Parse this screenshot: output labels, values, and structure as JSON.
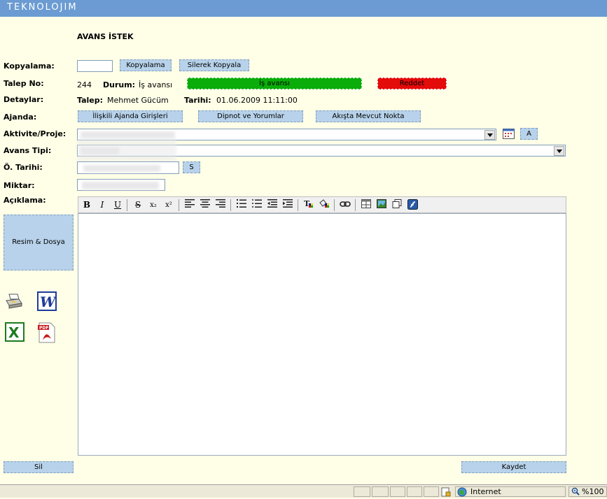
{
  "header": {
    "brand": "TEKNOLOJIM"
  },
  "page": {
    "title": "AVANS İSTEK"
  },
  "labels": {
    "kopyalama": "Kopyalama:",
    "talep_no": "Talep No:",
    "detaylar": "Detaylar:",
    "ajanda": "Ajanda:",
    "aktivite": "Aktivite/Proje:",
    "avans_tipi": "Avans Tipi:",
    "o_tarihi": "Ö. Tarihi:",
    "miktar": "Miktar:",
    "aciklama": "Açıklama:"
  },
  "buttons": {
    "kopyalama": "Kopyalama",
    "silerek_kopyala": "Silerek Kopyala",
    "is_avansi": "İş avansı",
    "reddet": "Reddet",
    "iliskili_ajanda": "İlişkili Ajanda Girişleri",
    "dipnot": "Dipnot ve Yorumlar",
    "akista": "Akışta Mevcut Nokta",
    "aktivite_a": "A",
    "tarih_s": "S",
    "resim_dosya": "Resim & Dosya",
    "sil": "Sil",
    "kaydet": "Kaydet"
  },
  "talep": {
    "no": "244",
    "durum_label": "Durum:",
    "durum_value": "İş avansı",
    "talep_label": "Talep:",
    "talep_value": "Mehmet Gücüm",
    "tarihi_label": "Tarihi:",
    "tarihi_value": "01.06.2009 11:11:00"
  },
  "toolbar": {
    "bold": "B",
    "italic": "I",
    "underline": "U",
    "strike": "S",
    "subscript": "x₂",
    "superscript": "x²"
  },
  "statusbar": {
    "zone": "Internet",
    "zoom": "%100"
  },
  "colors": {
    "topbar": "#6b9bd2",
    "button": "#b7d2ea",
    "approve": "#0aad0a",
    "reject": "#e40b0b",
    "background": "#ffffe8"
  }
}
